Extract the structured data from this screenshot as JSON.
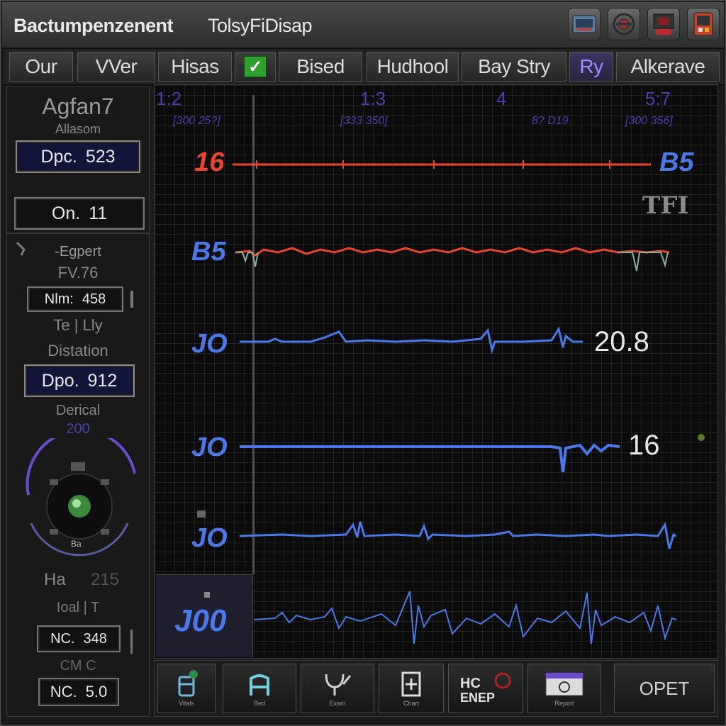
{
  "window": {
    "title": "Bactumpenzenent",
    "subtitle": "TolsyFiDisap",
    "buttons": [
      "monitor-icon",
      "settings-icon",
      "record-icon",
      "device-icon"
    ]
  },
  "tabs": [
    {
      "label": "Our"
    },
    {
      "label": "VVer"
    },
    {
      "label": "Hisas"
    },
    {
      "label": "",
      "checked": true
    },
    {
      "label": "Bised"
    },
    {
      "label": "Hudhool"
    },
    {
      "label": "Bay Stry"
    },
    {
      "label": "Ry",
      "active": true
    },
    {
      "label": "Alkerave"
    }
  ],
  "left_panel": {
    "heading": "Agfan7",
    "subheading": "Allasom",
    "box1": {
      "label": "Dpc.",
      "value": "523"
    },
    "box2": {
      "label": "On.",
      "value": "11"
    },
    "section2_title": "-Egpert",
    "section2_sub": "FV.76",
    "box3": {
      "label": "Nlm:",
      "value": "458"
    },
    "section3_title": "Te | Lly",
    "section3_sub": "Distation",
    "box4": {
      "label": "Dpo.",
      "value": "912"
    },
    "dial_label": "Derical",
    "dial_value": "200",
    "dial_center_text": "Ba",
    "ha_label": "Ha",
    "ha_value": "215",
    "small_text": "Ioal | T",
    "box5": {
      "label": "NC.",
      "value": "348"
    },
    "cm_label": "CM C",
    "box6": {
      "label": "NC.",
      "value": "5.0"
    }
  },
  "graph": {
    "header_numbers": [
      "1:2",
      "1:3",
      "4",
      "5:7"
    ],
    "header_labels": [
      "[300 25?]",
      "[333 350]",
      "8? D19",
      "[300 356]"
    ],
    "channels": [
      {
        "label": "16",
        "value": "B5",
        "color": "#e8452a"
      },
      {
        "label": "B5",
        "value": "TFI",
        "color": "#4a78e8"
      },
      {
        "label": "JO",
        "value": "20.8",
        "color": "#4a78e8"
      },
      {
        "label": "JO",
        "value": "16",
        "color": "#4a78e8"
      },
      {
        "label": "JO",
        "value": "",
        "color": "#4a78e8"
      },
      {
        "label": "J00",
        "value": "",
        "color": "#4a78e8"
      }
    ]
  },
  "bottom_bar": {
    "buttons": [
      {
        "icon": "patient-icon",
        "label": "Vitals"
      },
      {
        "icon": "bed-icon",
        "label": "Bed"
      },
      {
        "icon": "stethoscope-icon",
        "label": "Exam"
      },
      {
        "icon": "medical-chart-icon",
        "label": "Chart"
      },
      {
        "icon": "hc-logo-icon",
        "label": "HC ENEP"
      },
      {
        "icon": "report-icon",
        "label": "Report"
      },
      {
        "icon": "",
        "label": "OPET"
      }
    ]
  }
}
